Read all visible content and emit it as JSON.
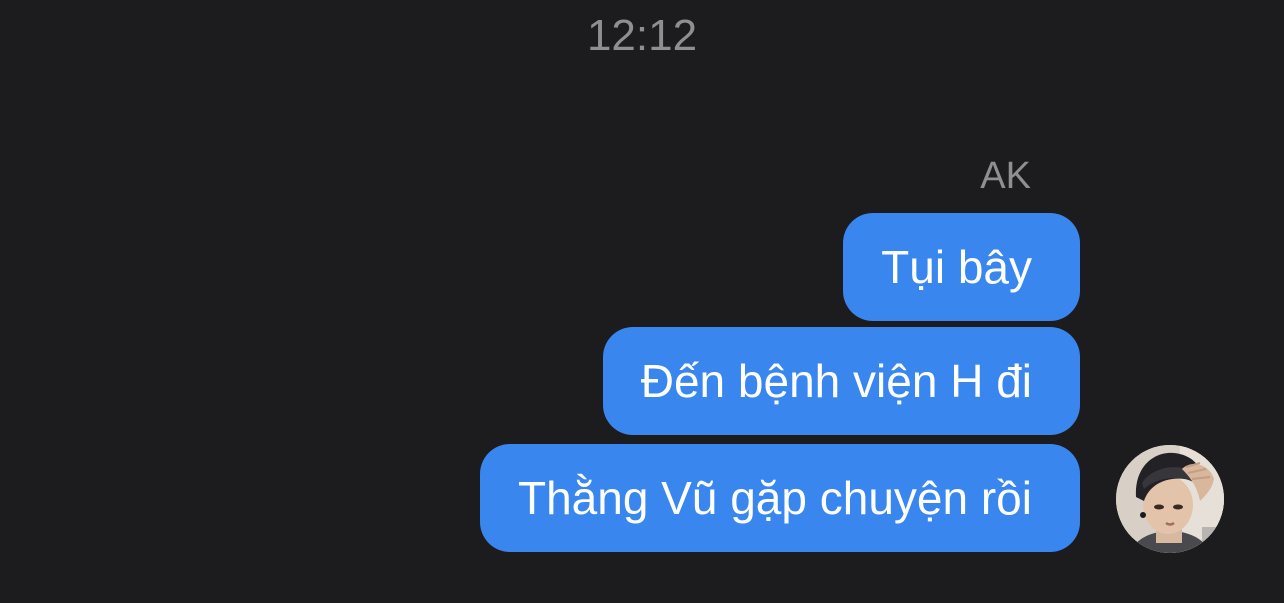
{
  "conversation": {
    "timestamp": "12:12",
    "sender_name": "AK",
    "messages": [
      {
        "text": "Tụi bây"
      },
      {
        "text": "Đến bệnh viện H đi"
      },
      {
        "text": "Thằng Vũ gặp chuyện rồi"
      }
    ],
    "bubble_color": "#3a86ef",
    "background_color": "#1c1c1e",
    "avatar_icon": "profile-photo"
  }
}
